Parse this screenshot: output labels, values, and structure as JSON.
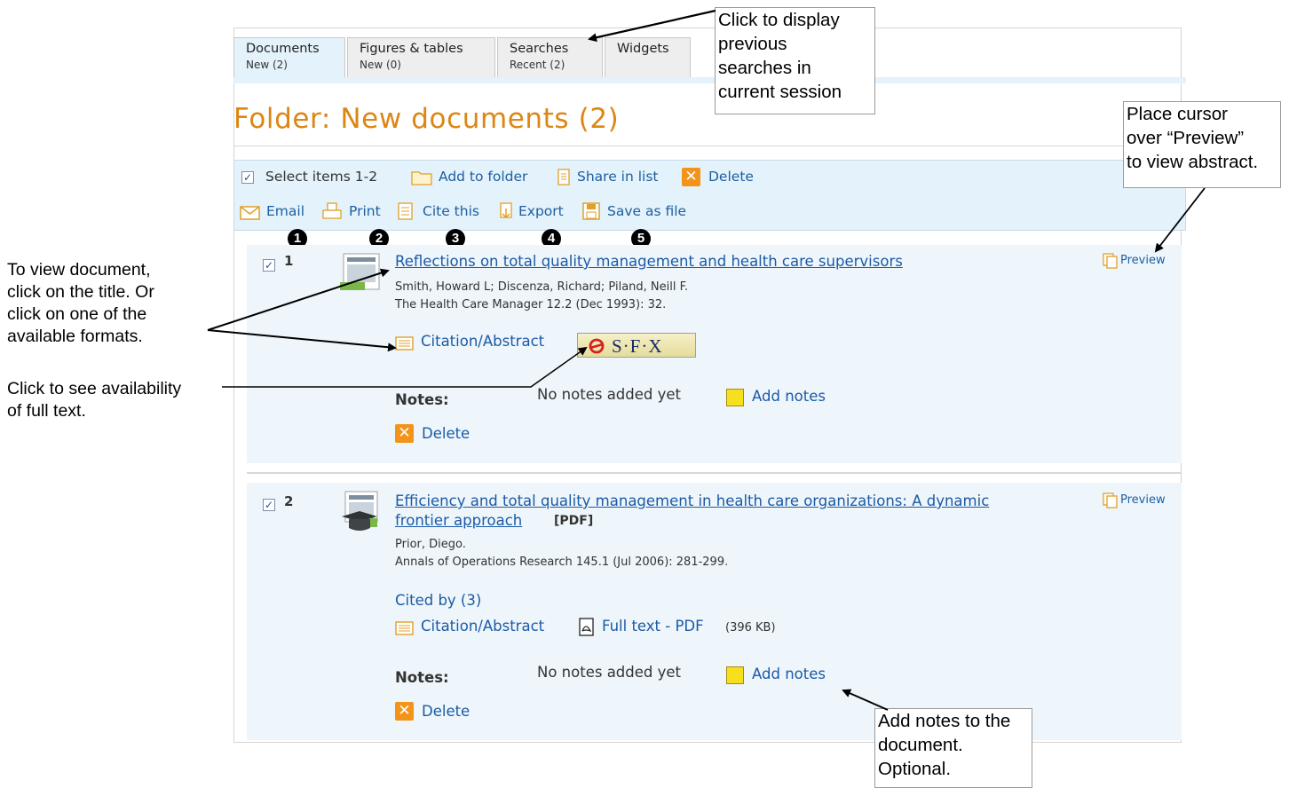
{
  "tabs": [
    {
      "label": "Documents",
      "sub": "New (2)"
    },
    {
      "label": "Figures & tables",
      "sub": "New (0)"
    },
    {
      "label": "Searches",
      "sub": "Recent (2)"
    },
    {
      "label": "Widgets"
    }
  ],
  "folder_title": "Folder: New documents (2)",
  "toolbar": {
    "select": "Select items 1-2",
    "add_to_folder": "Add to folder",
    "share": "Share in list",
    "delete": "Delete",
    "email": "Email",
    "print": "Print",
    "cite": "Cite this",
    "export": "Export",
    "save": "Save as file",
    "badges": [
      "1",
      "2",
      "3",
      "4",
      "5"
    ]
  },
  "records": [
    {
      "num": "1",
      "title": "Reflections on total quality management and health care supervisors",
      "authors": "Smith, Howard L; Discenza, Richard; Piland, Neill F.",
      "source": "The Health Care Manager 12.2 (Dec 1993): 32.",
      "citation": "Citation/Abstract",
      "sfx": "S·F·X",
      "notes_label": "Notes:",
      "notes_empty": "No notes added yet",
      "add_notes": "Add notes",
      "delete": "Delete",
      "preview": "Preview"
    },
    {
      "num": "2",
      "title_line1": "Efficiency and total quality management in health care organizations: A dynamic",
      "title_line2": "frontier approach",
      "format": "[PDF]",
      "authors": "Prior, Diego.",
      "source": "Annals of Operations Research 145.1 (Jul 2006): 281-299.",
      "cited_by": "Cited by (3)",
      "citation": "Citation/Abstract",
      "fulltext": "Full text - PDF",
      "fulltext_size": "(396 KB)",
      "notes_label": "Notes:",
      "notes_empty": "No notes added yet",
      "add_notes": "Add notes",
      "delete": "Delete",
      "preview": "Preview"
    }
  ],
  "callouts": {
    "searches": [
      "Click to display",
      "previous",
      "searches in",
      "current session"
    ],
    "preview": [
      "Place cursor",
      "over “Preview”",
      "to view abstract."
    ],
    "notes": [
      "Add notes to the",
      "document.",
      "Optional."
    ]
  },
  "annotations": {
    "view_doc": [
      "To view document,",
      "click on the title. Or",
      "click on one of the",
      "available formats."
    ],
    "fulltext": [
      "Click to see availability",
      "of full text."
    ]
  }
}
